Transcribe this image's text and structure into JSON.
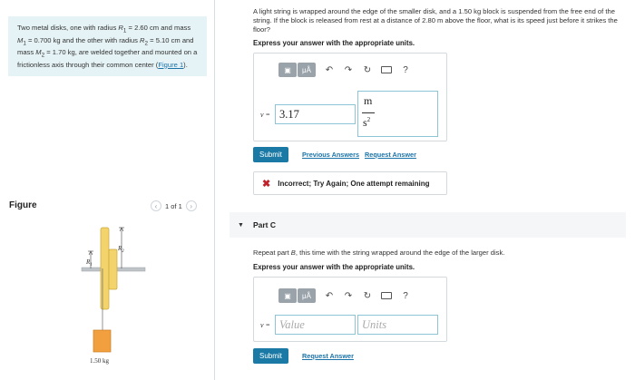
{
  "problem": {
    "text_html": "Two metal disks, one with radius <i>R</i><sub>1</sub> = 2.60 cm and mass <i>M</i><sub>1</sub> = 0.700 kg and the other with radius <i>R</i><sub>2</sub> = 5.10 cm and mass <i>M</i><sub>2</sub> = 1.70 kg, are welded together and mounted on a frictionless axis through their common center (",
    "figure_link": "Figure 1",
    "text_end": ")."
  },
  "figure": {
    "label": "Figure",
    "pager_text": "1 of 1",
    "prev_glyph": "‹",
    "next_glyph": "›",
    "r1_label": "R",
    "r1_sub": "1",
    "r2_label": "R",
    "r2_sub": "2",
    "block_label": "1.50 kg",
    "colors": {
      "disk": "#f3d36b",
      "disk_edge": "#c9a93a",
      "block": "#f2a03f",
      "axle": "#bfc4c8"
    }
  },
  "partB": {
    "question": "A light string is wrapped around the edge of the smaller disk, and a 1.50 kg block is suspended from the free end of the string. If the block is released from rest at a distance of 2.80 m above the floor, what is its speed just before it strikes the floor?",
    "instruction": "Express your answer with the appropriate units.",
    "var_label": "v =",
    "value": "3.17",
    "unit_numerator": "m",
    "unit_denominator": "s",
    "unit_exponent": "2",
    "submit_label": "Submit",
    "previous_answers_label": "Previous Answers",
    "request_answer_label": "Request Answer",
    "feedback": "Incorrect; Try Again; One attempt remaining"
  },
  "partC": {
    "title": "Part C",
    "caret": "▼",
    "question_html": "Repeat part <i>B</i>, this time with the string wrapped around the edge of the larger disk.",
    "instruction": "Express your answer with the appropriate units.",
    "var_label": "v =",
    "value_placeholder": "Value",
    "units_placeholder": "Units",
    "submit_label": "Submit",
    "request_answer_label": "Request Answer"
  },
  "toolbar": {
    "templates_icon": "templates-icon",
    "mu_label": "μÅ",
    "undo_glyph": "↶",
    "redo_glyph": "↷",
    "reset_glyph": "↻",
    "keyboard_icon": "keyboard-icon",
    "help_glyph": "?"
  },
  "colors": {
    "accent": "#1a7aa5",
    "link": "#1a73a8",
    "problem_bg": "#e6f3f6",
    "error": "#c0232c"
  }
}
